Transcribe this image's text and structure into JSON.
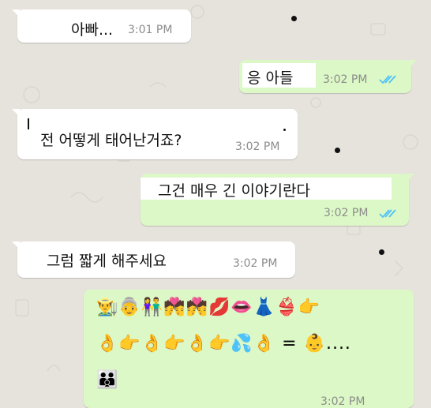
{
  "messages": [
    {
      "text": "아빠...",
      "time": "3:01 PM"
    },
    {
      "text": "응 아들",
      "time": "3:02 PM"
    },
    {
      "text": "전 어떻게 태어난거죠?",
      "time": "3:02 PM"
    },
    {
      "text": "그건 매우 긴 이야기란다",
      "time": "3:02 PM"
    },
    {
      "text": "그럼 짧게 해주세요",
      "time": "3:02 PM"
    }
  ],
  "emoji_message": {
    "rows": [
      "👨‍🌾👵👫💏💏💋👄👗👙👉",
      "👌👉👌👉👌👉💦👌 = 👶....",
      "👪"
    ],
    "time": "3:02 PM"
  },
  "colors": {
    "incoming": "#ffffff",
    "outgoing": "#dcf8c6",
    "read_ticks": "#4fc3f7",
    "timestamp": "#8c8c8c",
    "background": "#e6e3dd"
  }
}
